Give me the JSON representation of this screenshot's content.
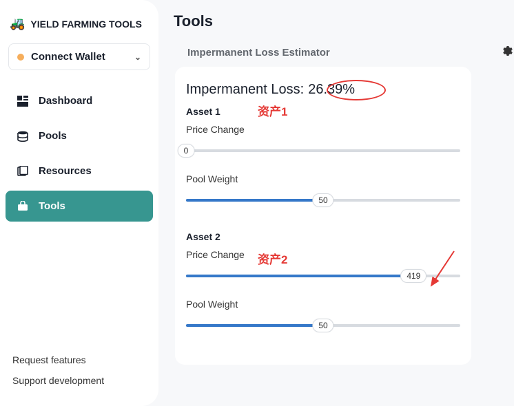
{
  "brand": {
    "icon": "🚜",
    "title": "YIELD FARMING TOOLS"
  },
  "wallet": {
    "label": "Connect Wallet"
  },
  "nav": {
    "dashboard": "Dashboard",
    "pools": "Pools",
    "resources": "Resources",
    "tools": "Tools"
  },
  "footer": {
    "request": "Request features",
    "support": "Support development"
  },
  "page": {
    "title": "Tools"
  },
  "estimator": {
    "title": "Impermanent Loss Estimator",
    "loss_label": "Impermanent Loss:",
    "loss_value": "26.39%",
    "asset1": {
      "label": "Asset 1",
      "price_change_label": "Price Change",
      "price_change_value": "0",
      "price_change_pct": 0,
      "pool_weight_label": "Pool Weight",
      "pool_weight_value": "50",
      "pool_weight_pct": 50
    },
    "asset2": {
      "label": "Asset 2",
      "price_change_label": "Price Change",
      "price_change_value": "419",
      "price_change_pct": 83,
      "pool_weight_label": "Pool Weight",
      "pool_weight_value": "50",
      "pool_weight_pct": 50
    }
  },
  "annotations": {
    "asset1_cn": "资产1",
    "asset2_cn": "资产2"
  }
}
